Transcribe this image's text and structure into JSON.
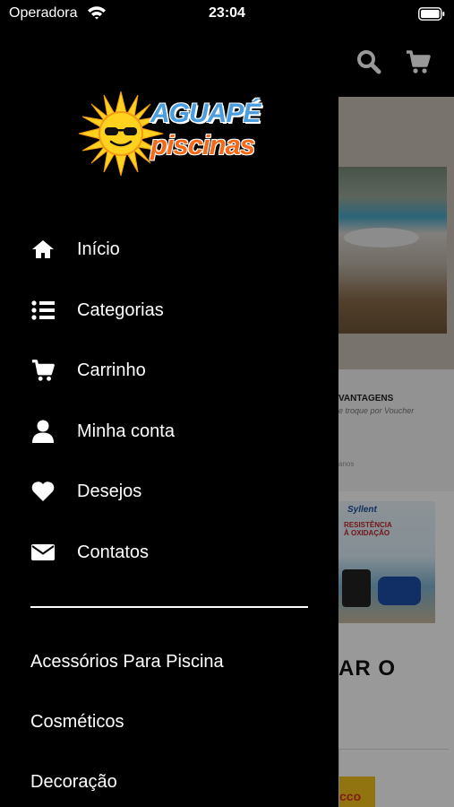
{
  "status_bar": {
    "carrier": "Operadora",
    "time": "23:04"
  },
  "logo": {
    "line1": "AGUAPÉ",
    "line2": "piscinas"
  },
  "menu": [
    {
      "label": "Início",
      "icon": "home-icon"
    },
    {
      "label": "Categorias",
      "icon": "list-icon"
    },
    {
      "label": "Carrinho",
      "icon": "cart-icon"
    },
    {
      "label": "Minha conta",
      "icon": "user-icon"
    },
    {
      "label": "Desejos",
      "icon": "heart-icon"
    },
    {
      "label": "Contatos",
      "icon": "envelope-icon"
    }
  ],
  "categories": [
    {
      "label": "Acessórios Para Piscina"
    },
    {
      "label": "Cosméticos"
    },
    {
      "label": "Decoração"
    }
  ],
  "background": {
    "vantagens_title": "VANTAGENS",
    "vantagens_sub": "e troque por Voucher",
    "vantagens_small": "anos",
    "promo_brand": "Syllent",
    "promo_text": "RESISTÊNCIA À OXIDAÇÃO",
    "section_heading": "AR O",
    "product_text": "cco"
  },
  "colors": {
    "drawer_bg": "#000000",
    "text": "#ffffff",
    "logo_blue": "#4a9ee0",
    "logo_orange": "#f46a1a",
    "logo_yellow": "#ffd21f"
  }
}
